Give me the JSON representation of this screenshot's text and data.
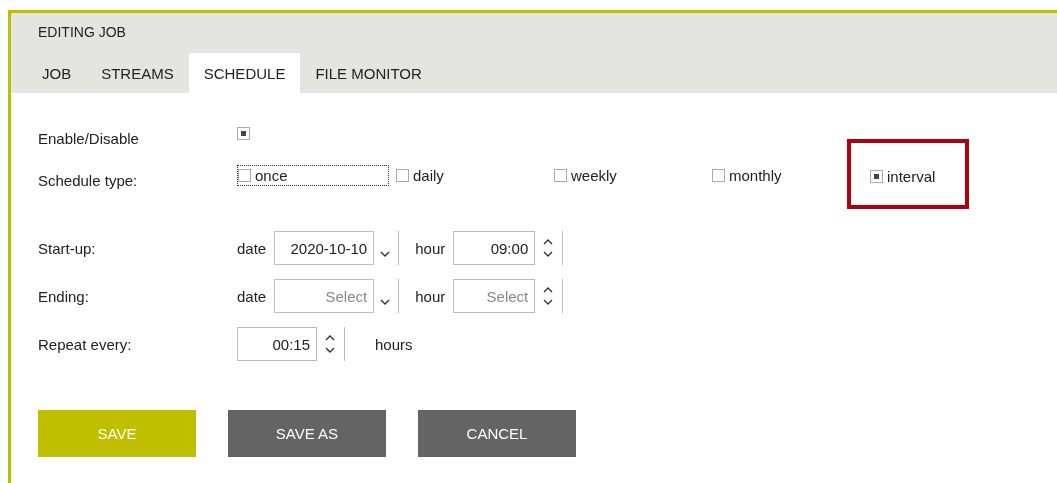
{
  "header": {
    "title": "EDITING JOB"
  },
  "tabs": [
    {
      "label": "JOB",
      "selected": false
    },
    {
      "label": "STREAMS",
      "selected": false
    },
    {
      "label": "SCHEDULE",
      "selected": true
    },
    {
      "label": "FILE MONITOR",
      "selected": false
    }
  ],
  "enable": {
    "label": "Enable/Disable",
    "checked": true
  },
  "schedule_type": {
    "label": "Schedule type:",
    "options": [
      {
        "label": "once",
        "checked": false,
        "focused": true,
        "highlighted": false
      },
      {
        "label": "daily",
        "checked": false,
        "focused": false,
        "highlighted": false
      },
      {
        "label": "weekly",
        "checked": false,
        "focused": false,
        "highlighted": false
      },
      {
        "label": "monthly",
        "checked": false,
        "focused": false,
        "highlighted": false
      },
      {
        "label": "interval",
        "checked": true,
        "focused": false,
        "highlighted": true
      }
    ]
  },
  "times": [
    {
      "label": "Start-up:",
      "date_label": "date",
      "date": {
        "value": "2020-10-10"
      },
      "hour_label": "hour",
      "hour": {
        "value": "09:00"
      }
    },
    {
      "label": "Ending:",
      "date_label": "date",
      "date": {
        "placeholder": "Select"
      },
      "hour_label": "hour",
      "hour": {
        "placeholder": "Select"
      }
    }
  ],
  "repeat": {
    "label": "Repeat every:",
    "value": "00:15",
    "unit": "hours"
  },
  "buttons": [
    {
      "label": "SAVE",
      "kind": "primary"
    },
    {
      "label": "SAVE AS",
      "kind": "secondary"
    },
    {
      "label": "CANCEL",
      "kind": "secondary"
    }
  ]
}
